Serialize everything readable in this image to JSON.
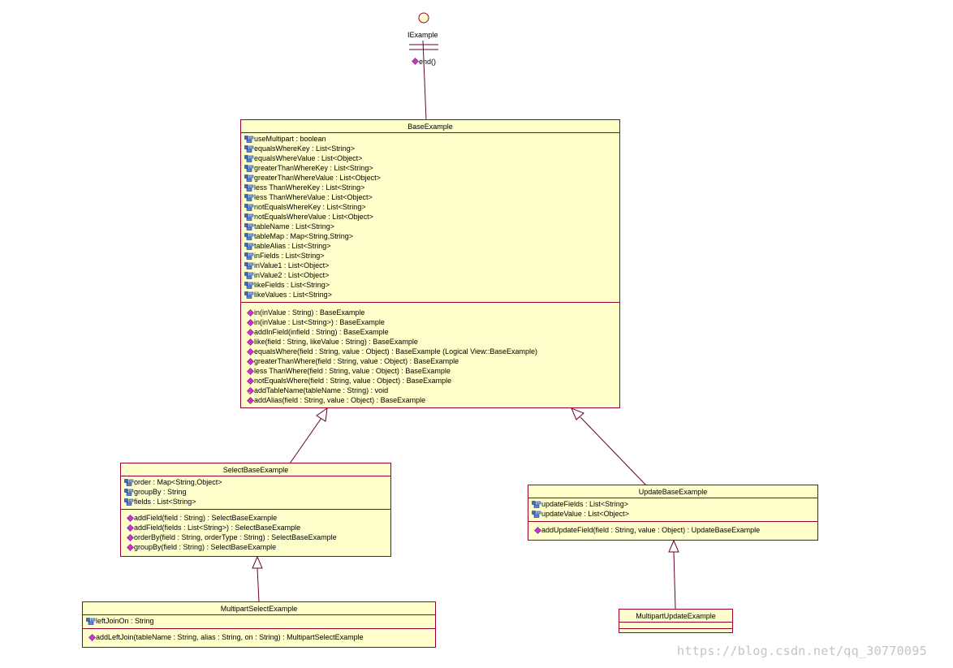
{
  "interface": {
    "name": "IExample",
    "operations": [
      "end()"
    ]
  },
  "classes": {
    "base": {
      "name": "BaseExample",
      "attributes": [
        "useMultipart : boolean",
        "equalsWhereKey : List<String>",
        "equalsWhereValue : List<Object>",
        "greaterThanWhereKey : List<String>",
        "greaterThanWhereValue : List<Object>",
        "less ThanWhereKey : List<String>",
        "less ThanWhereValue : List<Object>",
        "notEqualsWhereKey : List<String>",
        "notEqualsWhereValue : List<Object>",
        "tableName : List<String>",
        "tableMap : Map<String,String>",
        "tableAlias : List<String>",
        "inFields : List<String>",
        "inValue1 : List<Object>",
        "inValue2 : List<Object>",
        "likeFields : List<String>",
        "likeValues : List<String>"
      ],
      "operations": [
        "in(inValue : String) : BaseExample",
        "in(inValue : List<String>) : BaseExample",
        "addInField(infield : String) : BaseExample",
        "like(field : String, likeValue : String) : BaseExample",
        "equalsWhere(field : String, value : Object) : BaseExample   (Logical View::BaseExample)",
        "greaterThanWhere(field : String, value : Object) : BaseExample",
        "less ThanWhere(field : String, value : Object) : BaseExample",
        "notEqualsWhere(field : String, value : Object) : BaseExample",
        "addTableName(tableName : String) : void",
        "addAlias(field : String, value : Object) : BaseExample"
      ]
    },
    "select": {
      "name": "SelectBaseExample",
      "attributes": [
        "order : Map<String,Object>",
        "groupBy : String",
        "fields : List<String>"
      ],
      "operations": [
        "addField(field : String) : SelectBaseExample",
        "addField(fields : List<String>) : SelectBaseExample",
        "orderBy(field : String, orderType : String) : SelectBaseExample",
        "groupBy(field : String) : SelectBaseExample"
      ]
    },
    "update": {
      "name": "UpdateBaseExample",
      "attributes": [
        "updateFields : List<String>",
        "updateValue : List<Object>"
      ],
      "operations": [
        "addUpdateField(field : String, value : Object) : UpdateBaseExample"
      ]
    },
    "multipart_select": {
      "name": "MultipartSelectExample",
      "attributes": [
        "leftJoinOn : String"
      ],
      "operations": [
        "addLeftJoin(tableName : String, alias : String, on : String) : MultipartSelectExample"
      ]
    },
    "multipart_update": {
      "name": "MultipartUpdateExample",
      "attributes": [],
      "operations": []
    }
  },
  "watermark": "https://blog.csdn.net/qq_30770095",
  "colors": {
    "class_fill": "#ffffcc",
    "class_border": "#990033",
    "connector": "#660033",
    "attribute_icon": "#1a3a8a",
    "operation_icon": "#cc33cc"
  }
}
